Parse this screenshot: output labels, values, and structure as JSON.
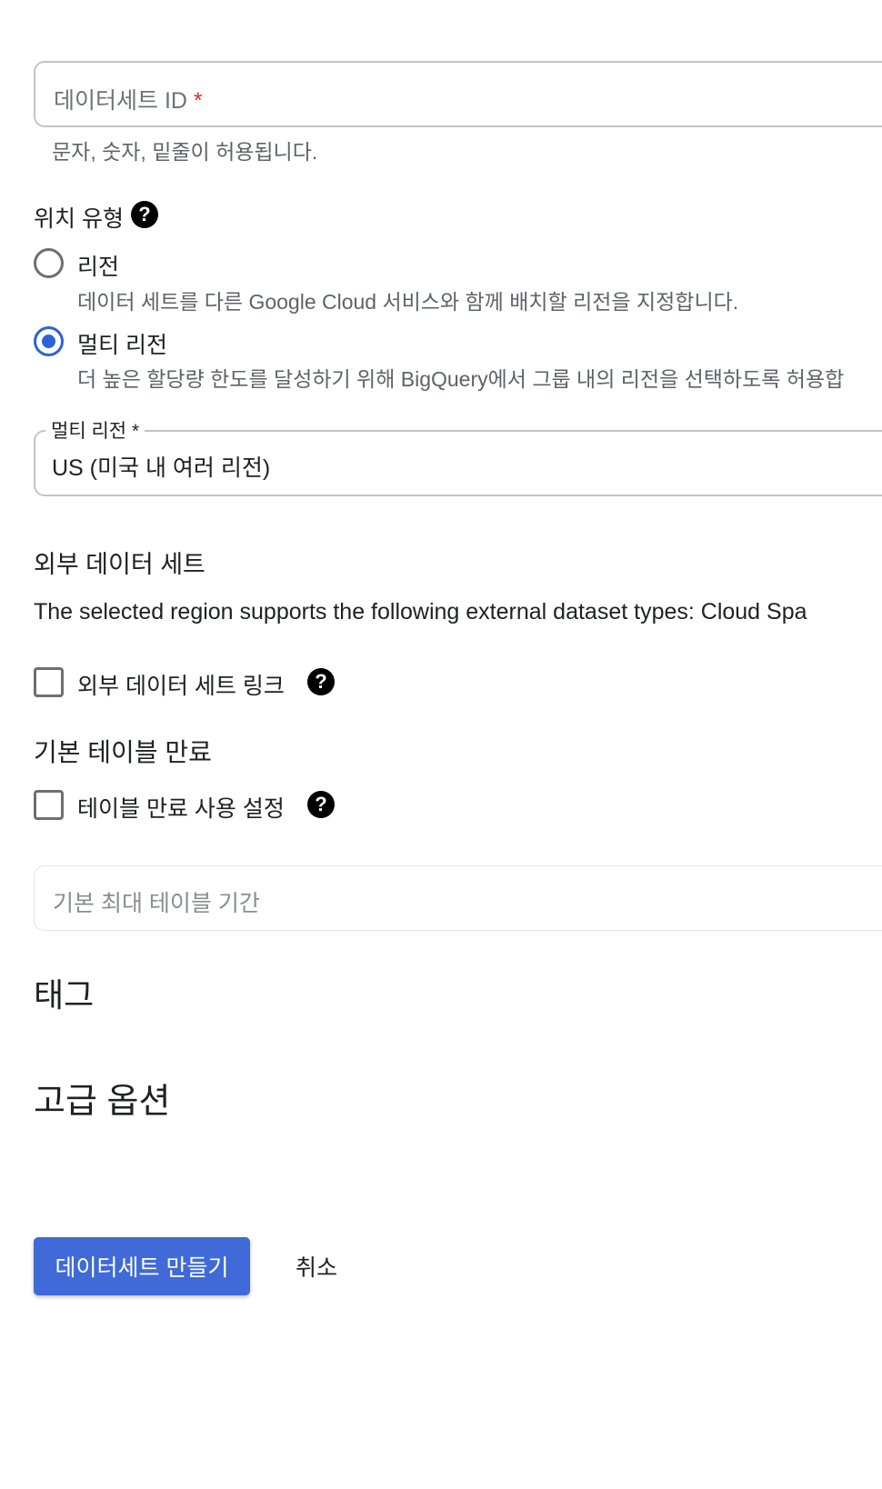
{
  "dataset_id_field": {
    "label": "데이터세트 ID",
    "required_mark": "*",
    "value": "",
    "hint": "문자, 숫자, 밑줄이 허용됩니다."
  },
  "location_type": {
    "heading": "위치 유형",
    "help_icon": "question-circle",
    "options": [
      {
        "label": "리전",
        "description": "데이터 세트를 다른 Google Cloud 서비스와 함께 배치할 리전을 지정합니다.",
        "selected": false
      },
      {
        "label": "멀티 리전",
        "description": "더 높은 할당량 한도를 달성하기 위해 BigQuery에서 그룹 내의 리전을 선택하도록 허용합",
        "selected": true
      }
    ]
  },
  "multi_region_select": {
    "label": "멀티 리전 *",
    "value": "US (미국 내 여러 리전)"
  },
  "external_dataset": {
    "heading": "외부 데이터 세트",
    "description": "The selected region supports the following external dataset types: Cloud Spa",
    "checkbox_label": "외부 데이터 세트 링크",
    "checked": false
  },
  "default_table_expiration": {
    "heading": "기본 테이블 만료",
    "checkbox_label": "테이블 만료 사용 설정",
    "checked": false,
    "max_age_placeholder": "기본 최대 테이블 기간"
  },
  "tags": {
    "heading": "태그"
  },
  "advanced": {
    "heading": "고급 옵션"
  },
  "actions": {
    "create_label": "데이터세트 만들기",
    "cancel_label": "취소"
  },
  "colors": {
    "accent": "#3f6ad8",
    "required": "#d93025",
    "help_icon": "#000000"
  }
}
